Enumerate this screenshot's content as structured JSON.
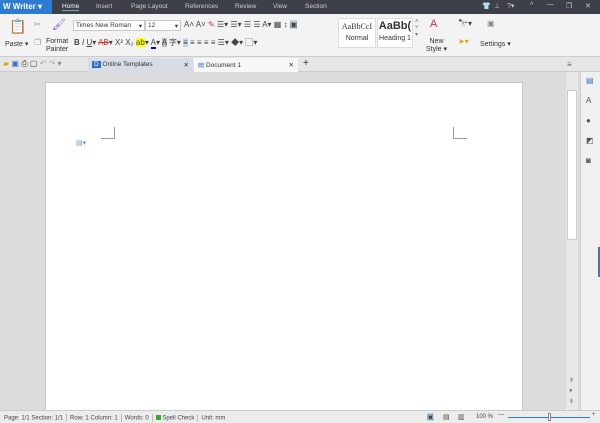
{
  "app": {
    "name": "Writer"
  },
  "menu_tabs": [
    "Home",
    "Insert",
    "Page Layout",
    "References",
    "Review",
    "View",
    "Section"
  ],
  "ribbon": {
    "paste": "Paste",
    "format_painter": [
      "Format",
      "Painter"
    ],
    "font": "Times New Roman",
    "size": "12",
    "styles": [
      {
        "preview": "AaBbCcI",
        "name": "Normal"
      },
      {
        "preview": "AaBb(",
        "name": "Heading 1"
      }
    ],
    "new_style": [
      "New",
      "Style"
    ],
    "settings": "Settings"
  },
  "doc_tabs": [
    "Online Templates",
    "Document 1"
  ],
  "status": {
    "page": "Page: 1/1",
    "section": "Section: 1/1",
    "row": "Row: 1",
    "column": "Column: 1",
    "words": "Words: 0",
    "spell": "Spell Check",
    "unit": "Unit: mm",
    "zoom": "100 %",
    "zoom_fraction": 0.5
  },
  "colors": {
    "accent": "#2d7bd2",
    "titlebar": "#3d4048"
  }
}
